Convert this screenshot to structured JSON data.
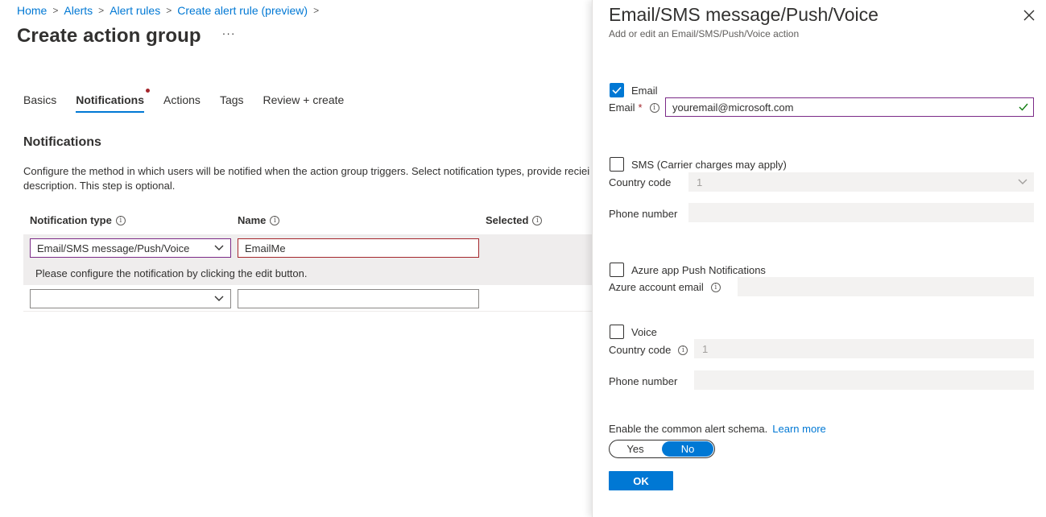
{
  "breadcrumb": [
    {
      "label": "Home"
    },
    {
      "label": "Alerts"
    },
    {
      "label": "Alert rules"
    },
    {
      "label": "Create alert rule (preview)"
    }
  ],
  "page": {
    "title": "Create action group",
    "more": "···"
  },
  "tabs": [
    {
      "label": "Basics"
    },
    {
      "label": "Notifications"
    },
    {
      "label": "Actions"
    },
    {
      "label": "Tags"
    },
    {
      "label": "Review + create"
    }
  ],
  "notifications": {
    "title": "Notifications",
    "description": "Configure the method in which users will be notified when the action group triggers. Select notification types, provide reciei description. This step is optional.",
    "columns": {
      "type": "Notification type",
      "name": "Name",
      "selected": "Selected"
    },
    "rows": [
      {
        "type": "Email/SMS message/Push/Voice",
        "name": "EmailMe",
        "note": "Please configure the notification by clicking the edit button."
      },
      {
        "type": "",
        "name": ""
      }
    ]
  },
  "panel": {
    "title": "Email/SMS message/Push/Voice",
    "subtitle": "Add or edit an Email/SMS/Push/Voice action",
    "email": {
      "check_label": "Email",
      "field_label": "Email",
      "required": "*",
      "value": "youremail@microsoft.com"
    },
    "sms": {
      "check_label": "SMS (Carrier charges may apply)",
      "country_label": "Country code",
      "country_value": "1",
      "phone_label": "Phone number"
    },
    "push": {
      "check_label": "Azure app Push Notifications",
      "account_label": "Azure account email"
    },
    "voice": {
      "check_label": "Voice",
      "country_label": "Country code",
      "country_value": "1",
      "phone_label": "Phone number"
    },
    "schema": {
      "label": "Enable the common alert schema.",
      "learn_more": "Learn more",
      "yes": "Yes",
      "no": "No"
    },
    "ok": "OK"
  },
  "colors": {
    "accent": "#0078d4",
    "required": "#a4262c",
    "focus_border": "#7b2a87",
    "valid": "#107c10"
  }
}
